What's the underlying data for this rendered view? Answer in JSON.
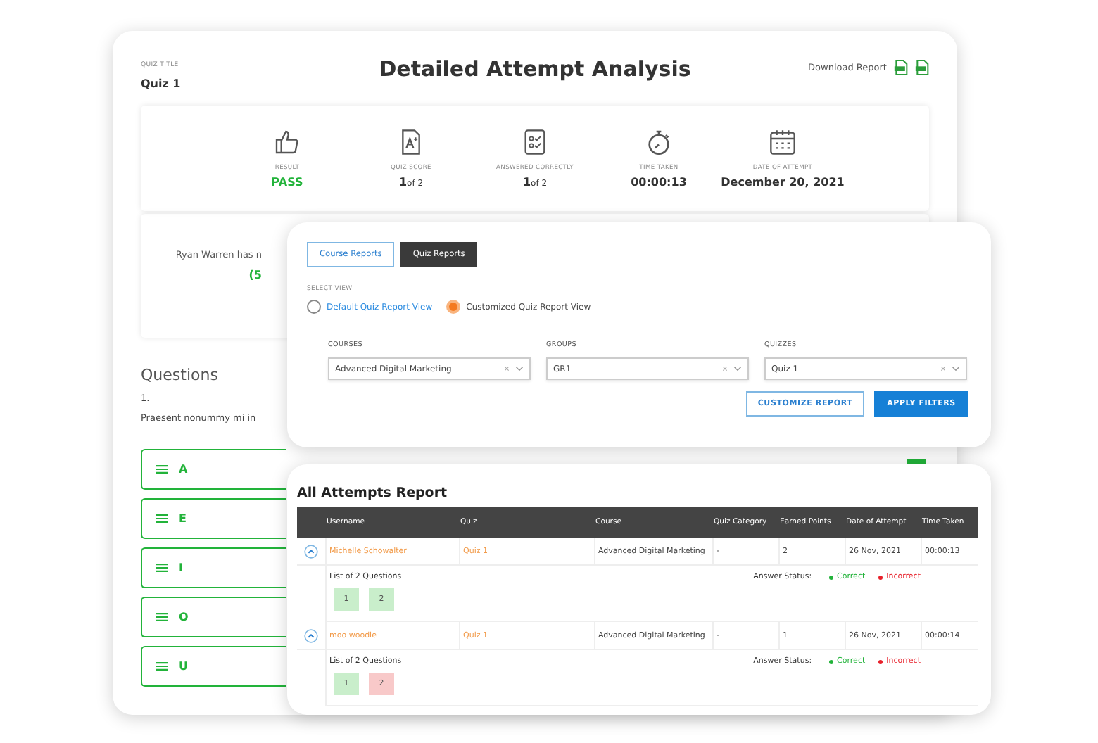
{
  "header": {
    "quiz_title_label": "QUIZ TITLE",
    "quiz_title": "Quiz 1",
    "title": "Detailed Attempt Analysis",
    "download_label": "Download Report"
  },
  "stats": [
    {
      "kind": "result",
      "label": "RESULT",
      "value": "PASS"
    },
    {
      "kind": "score",
      "label": "QUIZ SCORE",
      "value": "1",
      "suffix": "of 2"
    },
    {
      "kind": "correct",
      "label": "ANSWERED CORRECTLY",
      "value": "1",
      "suffix": "of 2"
    },
    {
      "kind": "time",
      "label": "TIME TAKEN",
      "value": "00:00:13"
    },
    {
      "kind": "date",
      "label": "DATE OF ATTEMPT",
      "value": "December 20, 2021"
    }
  ],
  "summary": {
    "text": "Ryan Warren has n",
    "score": "(5"
  },
  "questions": {
    "heading": "Questions",
    "number": "1.",
    "text": "Praesent nonummy mi in",
    "answers": [
      {
        "label": "A"
      },
      {
        "label": "E"
      },
      {
        "label": "I"
      },
      {
        "label": "O"
      },
      {
        "label": "U"
      }
    ]
  },
  "report_filters": {
    "tabs": [
      {
        "label": "Course Reports",
        "selected": false
      },
      {
        "label": "Quiz Reports",
        "selected": true
      }
    ],
    "view_label": "SELECT VIEW",
    "views": [
      {
        "label": "Default Quiz Report View",
        "selected": false
      },
      {
        "label": "Customized Quiz Report View",
        "selected": true
      }
    ],
    "filters": [
      {
        "label": "COURSES",
        "value": "Advanced Digital Marketing"
      },
      {
        "label": "GROUPS",
        "value": "GR1"
      },
      {
        "label": "QUIZZES",
        "value": "Quiz 1"
      }
    ],
    "buttons": [
      {
        "kind": "outline",
        "label": "CUSTOMIZE REPORT"
      },
      {
        "kind": "primary",
        "label": "APPLY FILTERS"
      }
    ]
  },
  "attempts_report": {
    "title": "All Attempts Report",
    "columns": [
      "Username",
      "Quiz",
      "Course",
      "Quiz Category",
      "Earned Points",
      "Date of Attempt",
      "Time Taken"
    ],
    "rows": [
      {
        "expanded": true,
        "cells": [
          "Michelle Schowalter",
          "Quiz 1",
          "Advanced Digital Marketing",
          "-",
          "2",
          "26 Nov, 2021",
          "00:00:13"
        ],
        "list_label": "List of 2 Questions",
        "status_label": "Answer Status:",
        "legend": [
          {
            "label": "Correct",
            "color": "#22b33a"
          },
          {
            "label": "Incorrect",
            "color": "#e8202a"
          }
        ],
        "questions": [
          {
            "number": "1",
            "correct": true
          },
          {
            "number": "2",
            "correct": true
          }
        ]
      },
      {
        "expanded": true,
        "cells": [
          "moo woodle",
          "Quiz 1",
          "Advanced Digital Marketing",
          "-",
          "1",
          "26 Nov, 2021",
          "00:00:14"
        ],
        "list_label": "List of 2 Questions",
        "status_label": "Answer Status:",
        "legend": [
          {
            "label": "Correct",
            "color": "#22b33a"
          },
          {
            "label": "Incorrect",
            "color": "#e8202a"
          }
        ],
        "questions": [
          {
            "number": "1",
            "correct": true
          },
          {
            "number": "2",
            "correct": false
          }
        ]
      }
    ]
  }
}
